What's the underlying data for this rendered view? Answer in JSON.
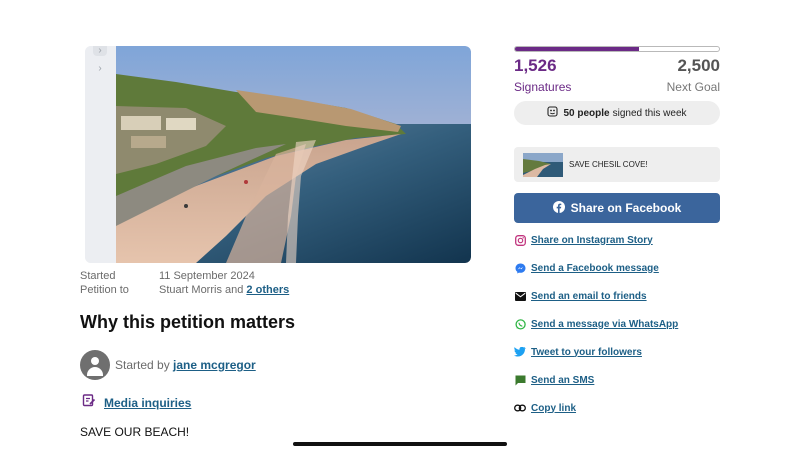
{
  "petition": {
    "started_label": "Started",
    "started_value": "11 September 2024",
    "petition_to_label": "Petition to",
    "petition_to_value": "Stuart Morris and ",
    "petition_to_others": "2 others",
    "heading": "Why this petition matters",
    "started_by_label": "Started by ",
    "started_by_name": "jane mcgregor",
    "media_inquiries": "Media inquiries",
    "body_text": "SAVE OUR BEACH!"
  },
  "signatures": {
    "count": "1,526",
    "count_label": "Signatures",
    "goal": "2,500",
    "goal_label": "Next Goal",
    "progress_fraction": 0.61,
    "week_count": "50 people",
    "week_text": "signed this week"
  },
  "share_card": {
    "title": "SAVE CHESIL COVE!"
  },
  "facebook_button": {
    "label": "Share on Facebook"
  },
  "share_links": [
    {
      "label": "Share on Instagram Story",
      "icon": "instagram-icon"
    },
    {
      "label": "Send a Facebook message",
      "icon": "messenger-icon"
    },
    {
      "label": "Send an email to friends",
      "icon": "email-icon"
    },
    {
      "label": "Send a message via WhatsApp",
      "icon": "whatsapp-icon"
    },
    {
      "label": "Tweet to your followers",
      "icon": "twitter-icon"
    },
    {
      "label": "Send an SMS",
      "icon": "sms-icon"
    },
    {
      "label": "Copy link",
      "icon": "link-icon"
    }
  ],
  "colors": {
    "accent_purple": "#6b2a86",
    "link_blue": "#1d5f86",
    "facebook_blue": "#3b659c"
  }
}
